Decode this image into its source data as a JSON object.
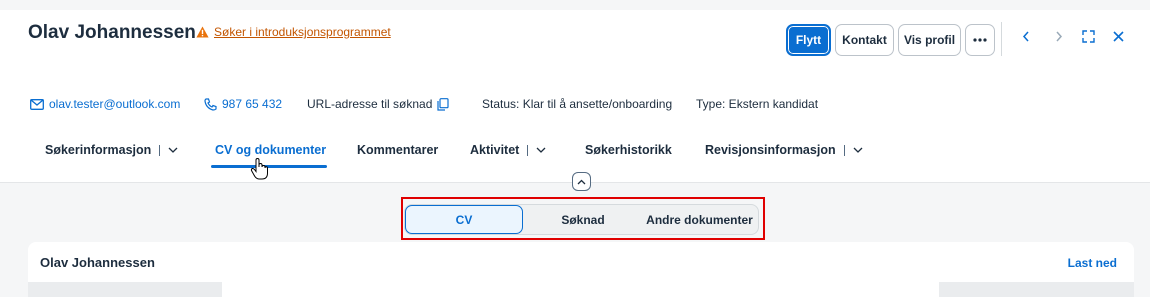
{
  "header": {
    "name": "Olav Johannessen",
    "warning": "Søker i introduksjonsprogrammet",
    "actions": {
      "move": "Flytt",
      "contact": "Kontakt",
      "view_profile": "Vis profil"
    }
  },
  "contact": {
    "email": "olav.tester@outlook.com",
    "phone": "987 65 432",
    "url_label": "URL-adresse til søknad",
    "status": "Status: Klar til å ansette/onboarding",
    "type": "Type: Ekstern kandidat"
  },
  "tabs": [
    {
      "label": "Søkerinformasjon"
    },
    {
      "label": "CV og dokumenter"
    },
    {
      "label": "Kommentarer"
    },
    {
      "label": "Aktivitet"
    },
    {
      "label": "Søkerhistorikk"
    },
    {
      "label": "Revisjonsinformasjon"
    }
  ],
  "segments": [
    {
      "label": "CV"
    },
    {
      "label": "Søknad"
    },
    {
      "label": "Andre dokumenter"
    }
  ],
  "panel": {
    "title": "Olav Johannessen",
    "download": "Last ned"
  },
  "colors": {
    "accent": "#0a6ed1",
    "warning": "#e9730c",
    "highlight": "#e00000"
  }
}
